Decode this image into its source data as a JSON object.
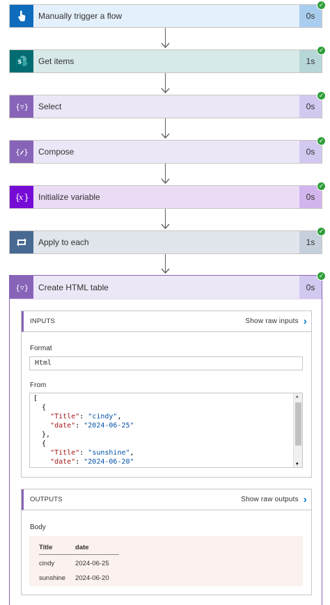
{
  "steps": [
    {
      "title": "Manually trigger a flow",
      "duration": "0s",
      "icon": "hand-tap-icon",
      "icon_color": "#0f6cbd",
      "bg": "#e4f0fb",
      "dur_bg": "#a9cdef"
    },
    {
      "title": "Get items",
      "duration": "1s",
      "icon": "sharepoint-icon",
      "icon_color": "#036c70",
      "bg": "#d8e9e9",
      "dur_bg": "#b6d6d7"
    },
    {
      "title": "Select",
      "duration": "0s",
      "icon": "data-operation-icon",
      "icon_color": "#8764b8",
      "bg": "#ece7f7",
      "dur_bg": "#d3c8ef"
    },
    {
      "title": "Compose",
      "duration": "0s",
      "icon": "compose-icon",
      "icon_color": "#8764b8",
      "bg": "#ece7f7",
      "dur_bg": "#d3c8ef"
    },
    {
      "title": "Initialize variable",
      "duration": "0s",
      "icon": "variable-icon",
      "icon_color": "#770bd6",
      "bg": "#ebdcf6",
      "dur_bg": "#d2b5ec"
    },
    {
      "title": "Apply to each",
      "duration": "1s",
      "icon": "loop-icon",
      "icon_color": "#486991",
      "bg": "#e1e6ec",
      "dur_bg": "#c6d0dc"
    }
  ],
  "expanded_step": {
    "title": "Create HTML table",
    "duration": "0s",
    "icon": "data-operation-icon",
    "icon_color": "#8764b8",
    "inputs": {
      "header": "INPUTS",
      "show_raw": "Show raw inputs",
      "format_label": "Format",
      "format_value": "Html",
      "from_label": "From",
      "from_lines": [
        "[",
        "  {",
        "    \"Title\": \"cindy\",",
        "    \"date\": \"2024-06-25\"",
        "  },",
        "  {",
        "    \"Title\": \"sunshine\",",
        "    \"date\": \"2024-06-20\""
      ]
    },
    "outputs": {
      "header": "OUTPUTS",
      "show_raw": "Show raw outputs",
      "body_label": "Body",
      "table_headers": [
        "Title",
        "date"
      ],
      "table_rows": [
        [
          "cindy",
          "2024-06-25"
        ],
        [
          "sunshine",
          "2024-06-20"
        ]
      ]
    }
  },
  "status_check": "✓"
}
